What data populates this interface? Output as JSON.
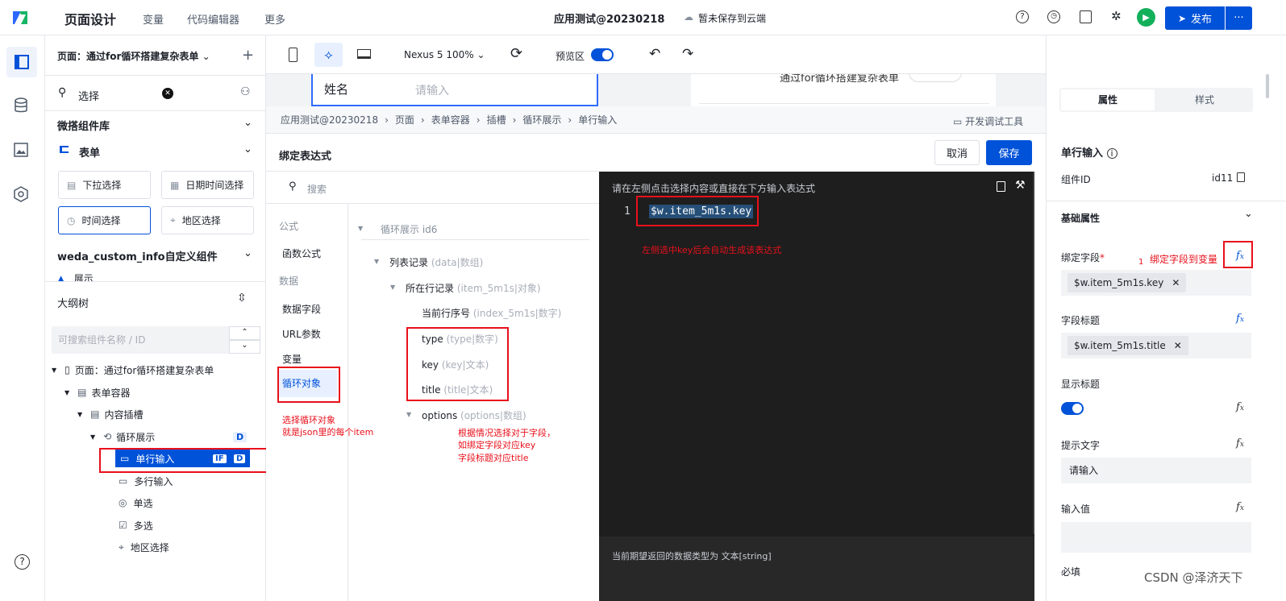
{
  "topbar": {
    "title": "页面设计",
    "menu": [
      "变量",
      "代码编辑器",
      "更多"
    ],
    "app_name": "应用测试@20230218",
    "cloud_status": "暂未保存到云端",
    "publish": "发布"
  },
  "left": {
    "page_select": "页面：通过for循环搭建复杂表单",
    "search_value": "选择",
    "lib_title": "微搭组件库",
    "form_group": "表单",
    "items": [
      "下拉选择",
      "日期时间选择",
      "时间选择",
      "地区选择"
    ],
    "custom_lib": "weda_custom_info自定义组件",
    "partial": "展示",
    "outline_title": "大纲树",
    "outline_placeholder": "可搜索组件名称 / ID",
    "tree": [
      "页面：通过for循环搭建复杂表单",
      "表单容器",
      "内容插槽",
      "循环展示",
      "单行输入",
      "多行输入",
      "单选",
      "多选",
      "地区选择"
    ],
    "badge_d": "D",
    "badge_if": "IF"
  },
  "toolbar": {
    "device": "Nexus 5 100%",
    "preview": "预览区"
  },
  "canvas": {
    "field_label": "姓名",
    "field_placeholder": "请输入",
    "phone_title": "通过for循环搭建复杂表单"
  },
  "breadcrumb": [
    "应用测试@20230218",
    "页面",
    "表单容器",
    "插槽",
    "循环展示",
    "单行输入"
  ],
  "devtools": "开发调试工具",
  "dialog": {
    "title": "绑定表达式",
    "cancel": "取消",
    "save": "保存",
    "search_placeholder": "搜索",
    "cat_formula": "公式",
    "func": "函数公式",
    "cat_data": "数据",
    "data_items": [
      "数据字段",
      "URL参数",
      "变量",
      "循环对象"
    ],
    "vars": {
      "root": "循环展示 id6",
      "list": "列表记录",
      "list_meta": "(data|数组)",
      "row": "所在行记录",
      "row_meta": "(item_5m1s|对象)",
      "index": "当前行序号",
      "index_meta": "(index_5m1s|数字)",
      "type": "type",
      "type_meta": "(type|数字)",
      "key": "key",
      "key_meta": "(key|文本)",
      "title": "title",
      "title_meta": "(title|文本)",
      "options": "options",
      "options_meta": "(options|数组)"
    },
    "editor_hint": "请在左侧点击选择内容或直接在下方输入表达式",
    "line_no": "1",
    "code": "$w.item_5m1s.key",
    "return_type": "当前期望返回的数据类型为 文本[string]"
  },
  "annotations": {
    "a1": "左侧选中key后会自动生成该表达式",
    "a2_1": "选择循环对象",
    "a2_2": "就是json里的每个item",
    "a3_1": "根据情况选择对于字段，",
    "a3_2": "如绑定字段对应key",
    "a3_3": "字段标题对应title",
    "a4": "绑定字段到变量",
    "a4_num": "1"
  },
  "right": {
    "tab_props": "属性",
    "tab_style": "样式",
    "comp_name": "单行输入",
    "comp_id_label": "组件ID",
    "comp_id": "id11",
    "basic": "基础属性",
    "bind_label": "绑定字段",
    "bind_value": "$w.item_5m1s.key",
    "title_label": "字段标题",
    "title_value": "$w.item_5m1s.title",
    "show_title": "显示标题",
    "hint_label": "提示文字",
    "hint_value": "请输入",
    "input_label": "输入值",
    "required": "必填",
    "fx": "fx",
    "star": "*"
  },
  "watermark": "CSDN @泽济天下",
  "colors": {
    "brand": "#0052d9",
    "red": "#e8101b",
    "dark": "#1e1e1e"
  }
}
